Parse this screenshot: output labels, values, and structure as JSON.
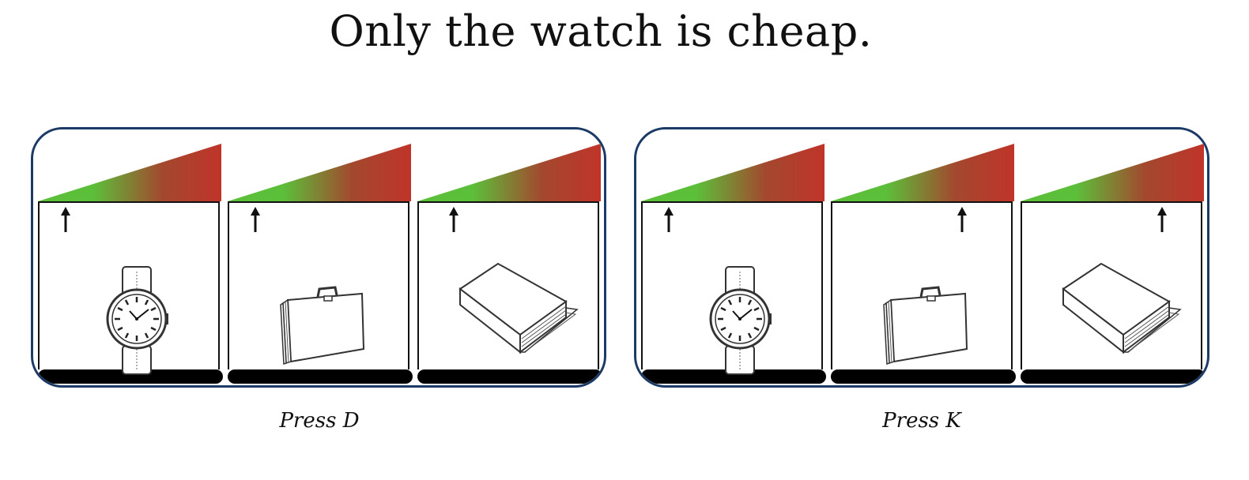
{
  "title": "Only the watch is cheap.",
  "gradient": {
    "cheap_color": "#5cbf3a",
    "expensive_color": "#c0342a"
  },
  "options": [
    {
      "key_label": "Press D",
      "items": [
        {
          "object": "watch-icon",
          "price_level": 0.15
        },
        {
          "object": "briefcase-icon",
          "price_level": 0.15
        },
        {
          "object": "book-icon",
          "price_level": 0.2
        }
      ]
    },
    {
      "key_label": "Press K",
      "items": [
        {
          "object": "watch-icon",
          "price_level": 0.15
        },
        {
          "object": "briefcase-icon",
          "price_level": 0.72
        },
        {
          "object": "book-icon",
          "price_level": 0.78
        }
      ]
    }
  ]
}
